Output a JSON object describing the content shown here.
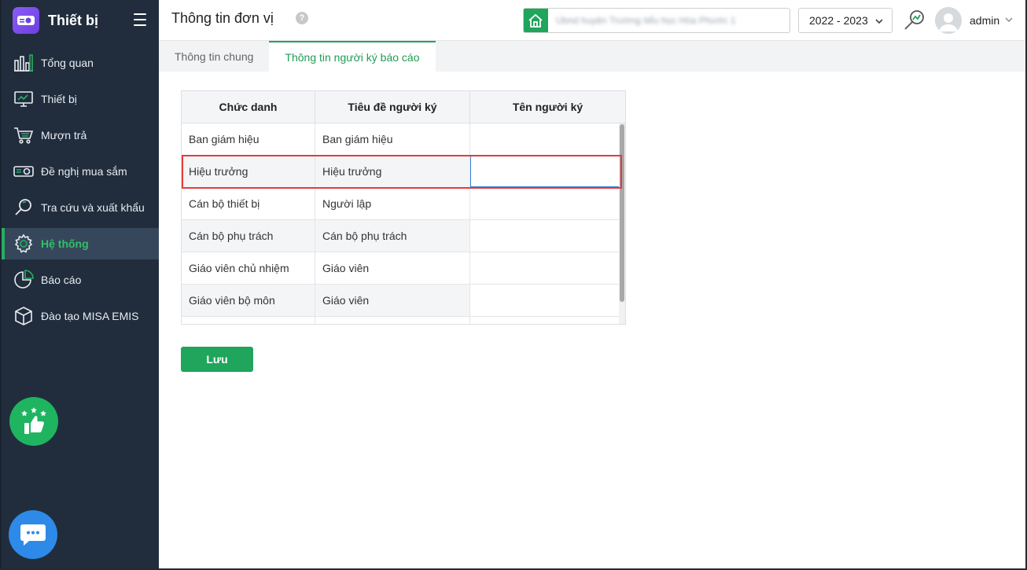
{
  "sidebar": {
    "app_title": "Thiết bị",
    "items": [
      {
        "label": "Tổng quan",
        "icon": "dashboard-bars-icon"
      },
      {
        "label": "Thiết bị",
        "icon": "monitor-icon"
      },
      {
        "label": "Mượn trả",
        "icon": "cart-icon"
      },
      {
        "label": "Đề nghị mua sắm",
        "icon": "projector-icon"
      },
      {
        "label": "Tra cứu và xuất khẩu",
        "icon": "search-icon"
      },
      {
        "label": "Hệ thống",
        "icon": "gear-icon",
        "active": true
      },
      {
        "label": "Báo cáo",
        "icon": "pie-chart-icon"
      },
      {
        "label": "Đào tạo MISA EMIS",
        "icon": "cube-icon"
      }
    ]
  },
  "header": {
    "title": "Thông tin đơn vị",
    "help": "?",
    "school_name": "Ubnd huyện Trường tiểu học Hòa Phước 1",
    "year": "2022 - 2023",
    "user": "admin"
  },
  "tabs": [
    {
      "label": "Thông tin chung",
      "active": false
    },
    {
      "label": "Thông tin người ký báo cáo",
      "active": true
    }
  ],
  "table": {
    "columns": [
      "Chức danh",
      "Tiêu đề người ký",
      "Tên người ký"
    ],
    "rows": [
      [
        "Ban giám hiệu",
        "Ban giám hiệu",
        ""
      ],
      [
        "Hiệu trưởng",
        "Hiệu trưởng",
        ""
      ],
      [
        "Cán bộ thiết bị",
        "Người lập",
        ""
      ],
      [
        "Cán bộ phụ trách",
        "Cán bộ phụ trách",
        ""
      ],
      [
        "Giáo viên chủ nhiệm",
        "Giáo viên",
        ""
      ],
      [
        "Giáo viên bộ môn",
        "Giáo viên",
        ""
      ],
      [
        "",
        "",
        ""
      ]
    ]
  },
  "actions": {
    "save_label": "Lưu"
  },
  "colors": {
    "sidebar_bg": "#212d3d",
    "accent_green": "#1fa55c",
    "highlight_red": "#e53a3a",
    "focus_blue": "#3a83d6"
  }
}
